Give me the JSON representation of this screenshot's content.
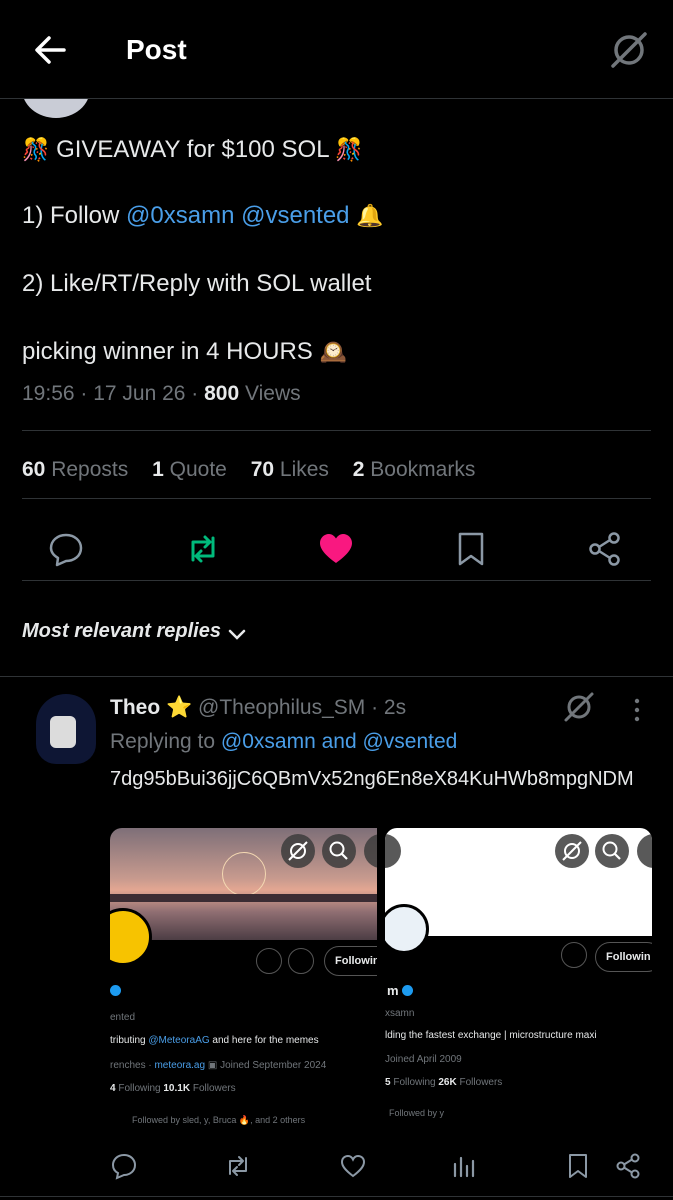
{
  "header": {
    "title": "Post"
  },
  "tweet": {
    "line1": {
      "emoji_left": "🎊",
      "text": "GIVEAWAY for $100 SOL",
      "emoji_right": "🎊"
    },
    "line2": {
      "prefix": "1) Follow ",
      "mention1": "@0xsamn",
      "mention2": "@vsented",
      "emoji": "🔔"
    },
    "line3": "2) Like/RT/Reply with SOL wallet",
    "line4": {
      "text": "picking winner in 4 HOURS",
      "emoji": "🕰️"
    },
    "meta": {
      "time": "19:56 · 17 Jun 26 · ",
      "views_count": "800",
      "views_label": " Views"
    }
  },
  "stats": {
    "reposts": {
      "count": "60",
      "label": "Reposts"
    },
    "quotes": {
      "count": "1",
      "label": "Quote"
    },
    "likes": {
      "count": "70",
      "label": "Likes"
    },
    "bookmarks": {
      "count": "2",
      "label": "Bookmarks"
    }
  },
  "actions": [
    {
      "icon": "reply-icon"
    },
    {
      "icon": "repost-icon",
      "color": "#00ba7c"
    },
    {
      "icon": "heart-icon",
      "color": "#f91880"
    },
    {
      "icon": "bookmark-icon"
    },
    {
      "icon": "share-icon"
    }
  ],
  "sort": {
    "label": "Most relevant replies"
  },
  "reply": {
    "name": "Theo",
    "badge": "⭐",
    "handle": "@Theophilus_SM",
    "time": " · 2s",
    "replying_label": "Replying to ",
    "replying_to": "@0xsamn and @vsented",
    "text": "7dg95bBui36jjC6QBmVx52ng6En8eX84KuHWb8mpgNDM",
    "card_a": {
      "follow_label": "Followin",
      "name_line": "ented",
      "bio_prefix": "tributing ",
      "bio_link": "@MeteoraAG",
      "bio_suffix": " and here for the memes",
      "info_left": "renches",
      "info_link": "meteora.ag",
      "joined": "Joined September 2024",
      "following_count": "4",
      "following_label": "Following",
      "followers_count": "10.1K",
      "followers_label": "Followers",
      "followed_by": "Followed by sled, y, Bruca 🔥, and 2 others"
    },
    "card_b": {
      "follow_label": "Followin",
      "name_line": "m",
      "handle": "xsamn",
      "bio": "lding the fastest exchange | microstructure maxi",
      "joined": "Joined April 2009",
      "following_count": "5",
      "following_label": "Following",
      "followers_count": "26K",
      "followers_label": "Followers",
      "followed_by": "Followed by y"
    }
  },
  "colors": {
    "accent": "#4a9ee8",
    "muted": "#71767b",
    "background": "#000000"
  }
}
